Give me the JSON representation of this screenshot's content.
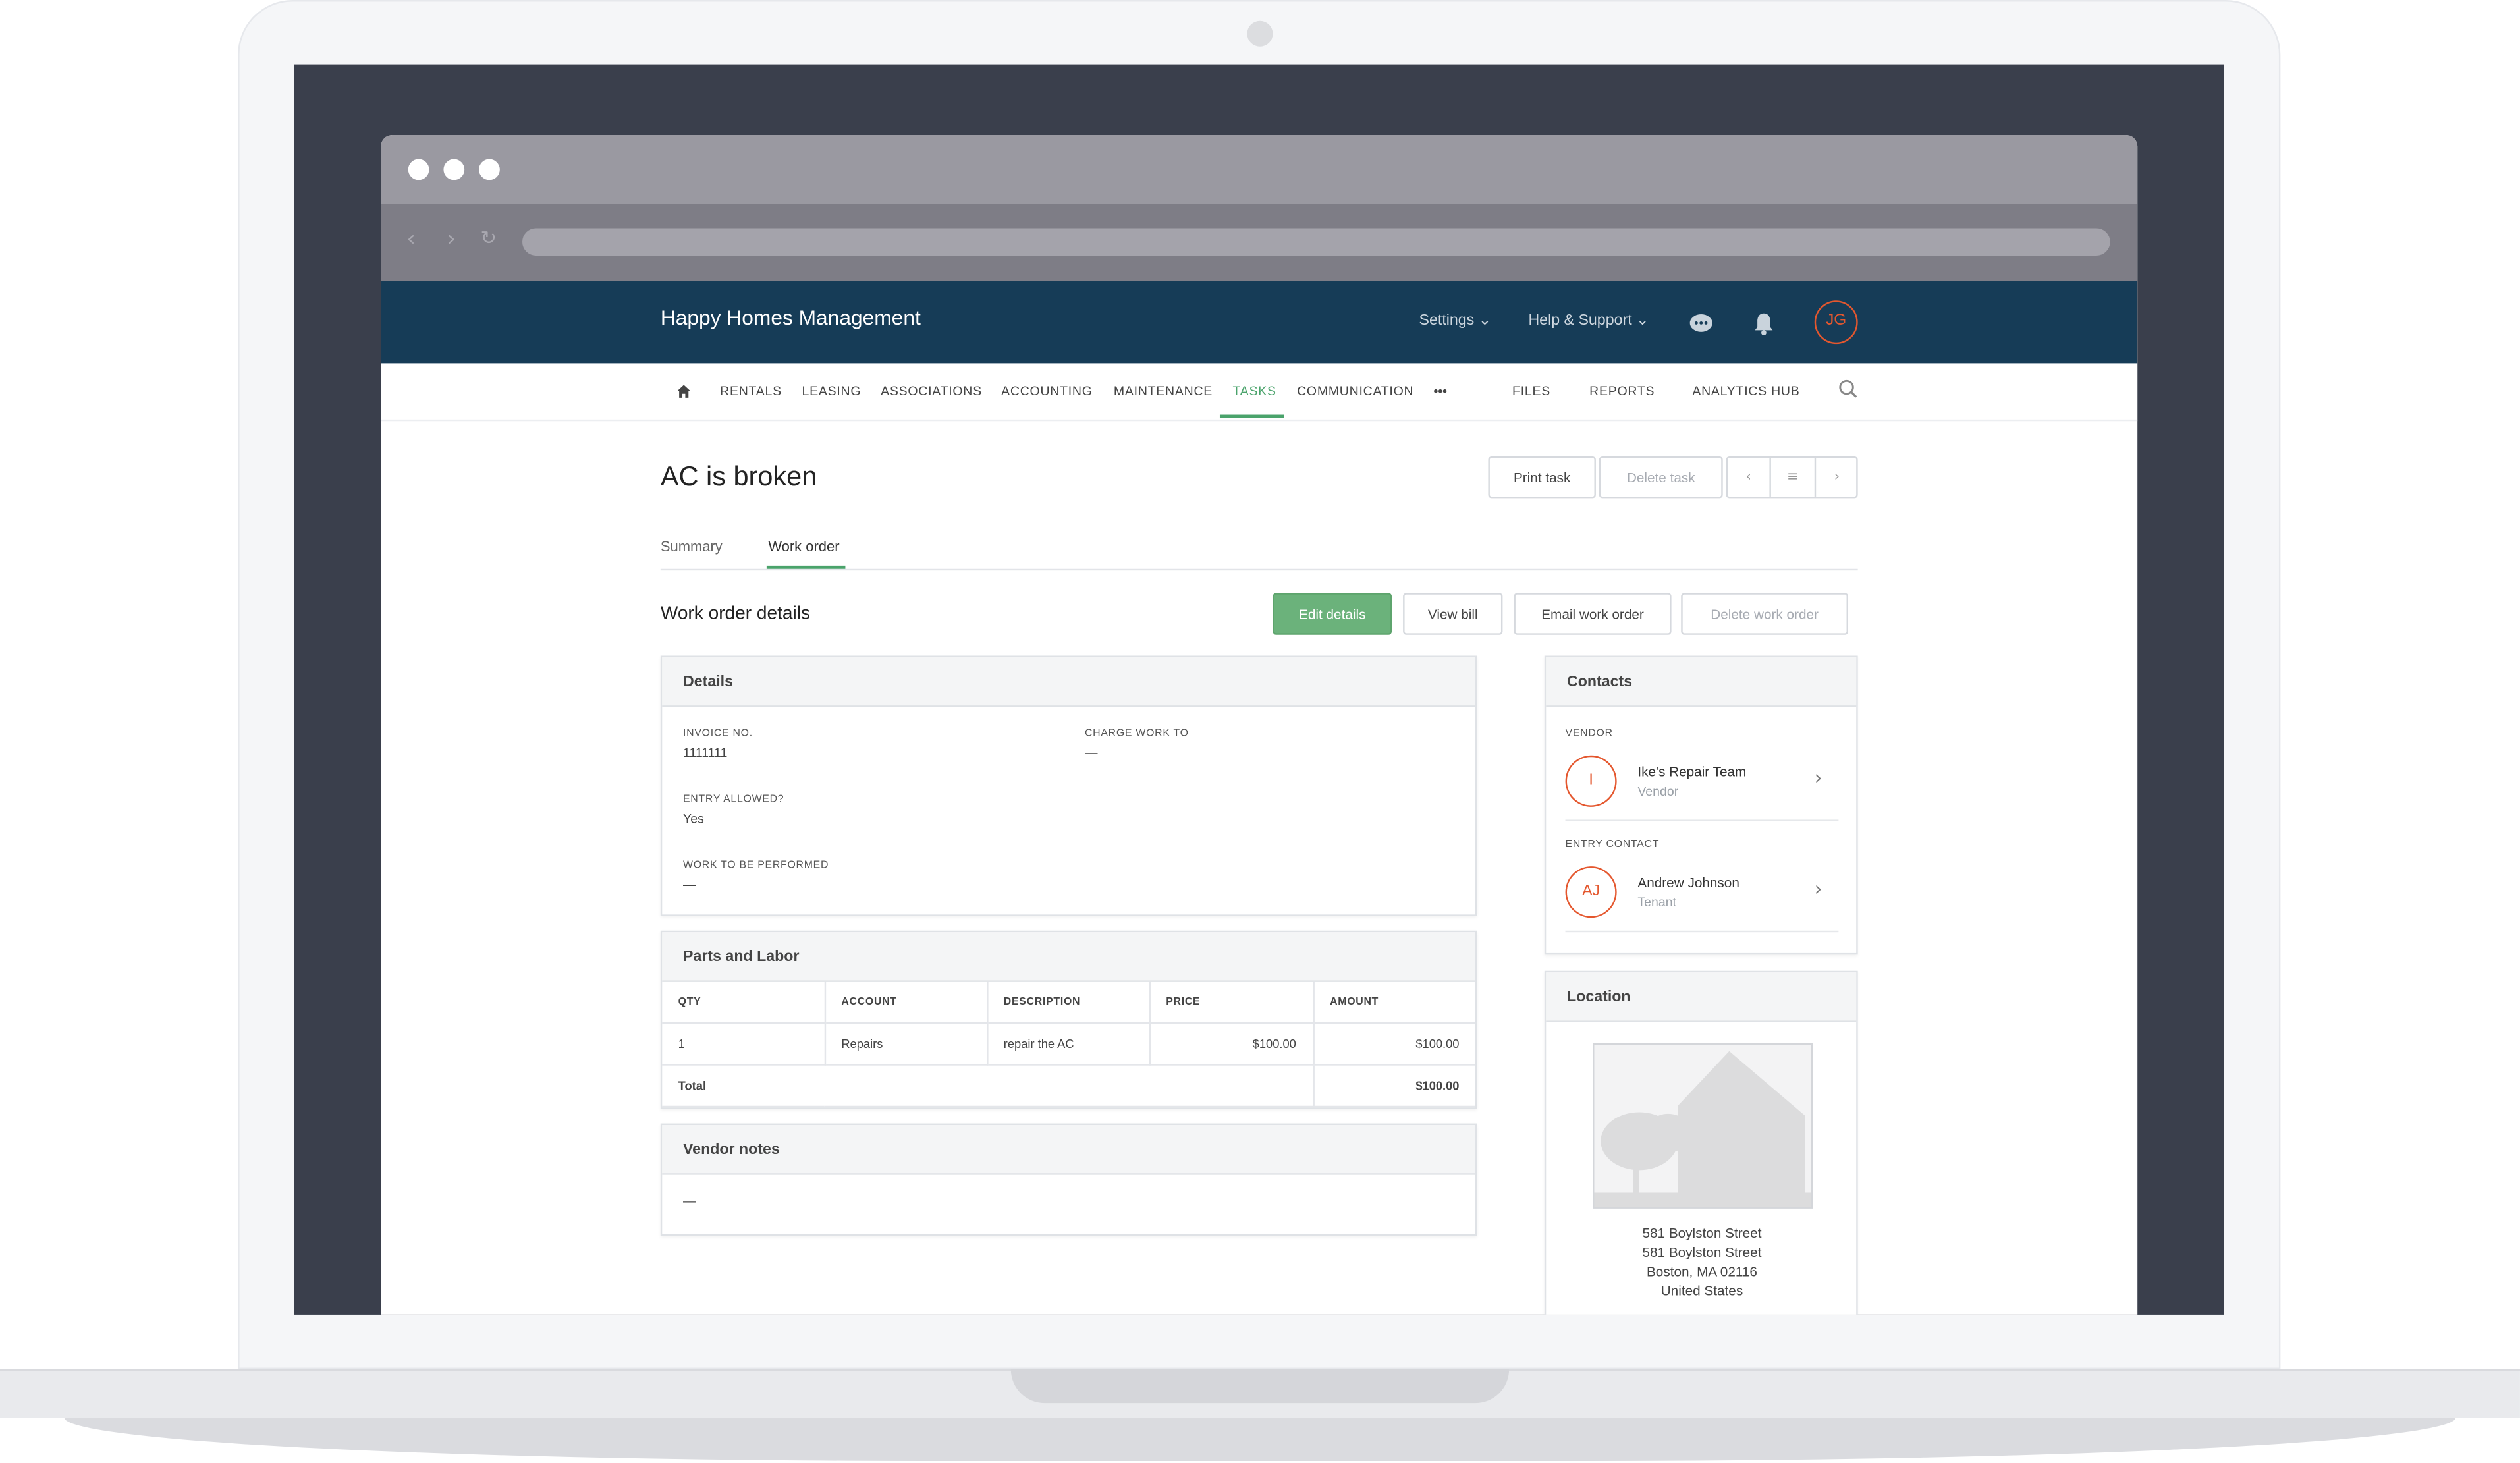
{
  "app": {
    "brand": "Happy Homes Management",
    "header_links": [
      "Settings",
      "Help & Support"
    ],
    "user_initials": "JG"
  },
  "nav": {
    "home_icon": "home-icon",
    "items": [
      "RENTALS",
      "LEASING",
      "ASSOCIATIONS",
      "ACCOUNTING",
      "MAINTENANCE",
      "TASKS",
      "COMMUNICATION",
      "FILES",
      "REPORTS",
      "ANALYTICS HUB"
    ],
    "active": "TASKS",
    "more": "•••"
  },
  "task": {
    "title": "AC is broken",
    "print_label": "Print task",
    "delete_label": "Delete task"
  },
  "tabs": [
    "Summary",
    "Work order"
  ],
  "active_tab": "Work order",
  "work_order": {
    "heading": "Work order details",
    "actions": [
      "Edit details",
      "View bill",
      "Email work order",
      "Delete work order"
    ]
  },
  "details": {
    "title": "Details",
    "invoice_label": "INVOICE NO.",
    "invoice_value": "1111111",
    "charge_label": "CHARGE WORK TO",
    "charge_value": "—",
    "entry_label": "ENTRY ALLOWED?",
    "entry_value": "Yes",
    "work_label": "WORK TO BE PERFORMED",
    "work_value": "—"
  },
  "parts": {
    "title": "Parts and Labor",
    "columns": [
      "QTY",
      "ACCOUNT",
      "DESCRIPTION",
      "PRICE",
      "AMOUNT"
    ],
    "rows": [
      [
        "1",
        "Repairs",
        "repair the AC",
        "$100.00",
        "$100.00"
      ]
    ],
    "total_label": "Total",
    "total_value": "$100.00"
  },
  "vendor_notes": {
    "title": "Vendor notes",
    "value": "—"
  },
  "contacts": {
    "title": "Contacts",
    "vendor_label": "VENDOR",
    "vendor": {
      "initials": "I",
      "name": "Ike's Repair Team",
      "role": "Vendor"
    },
    "entry_label": "ENTRY CONTACT",
    "entry": {
      "initials": "AJ",
      "name": "Andrew Johnson",
      "role": "Tenant"
    }
  },
  "location": {
    "title": "Location",
    "link": "581 Boylston Street",
    "street": "581 Boylston Street",
    "city": "Boston, MA 02116",
    "country": "United States"
  },
  "colors": {
    "header_bg": "#163c57",
    "accent_green": "#4aa36b",
    "avatar_orange": "#e4572e",
    "link_blue": "#2b7cc0"
  }
}
